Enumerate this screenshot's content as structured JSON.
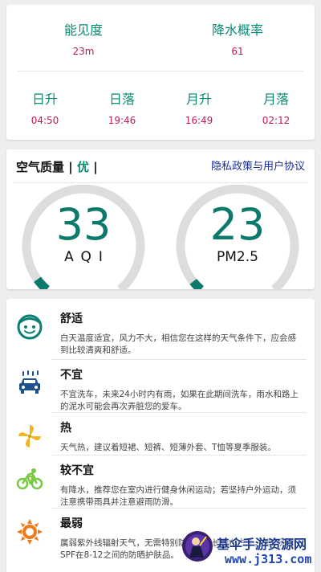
{
  "astro": {
    "visibility": {
      "label": "能见度",
      "value": "23m"
    },
    "precip_chance": {
      "label": "降水概率",
      "value": "61"
    },
    "sunrise": {
      "label": "日升",
      "value": "04:50"
    },
    "sunset": {
      "label": "日落",
      "value": "19:46"
    },
    "moonrise": {
      "label": "月升",
      "value": "16:49"
    },
    "moonset": {
      "label": "月落",
      "value": "02:12"
    }
  },
  "air": {
    "title_prefix": "空气质量 |",
    "quality": "优",
    "title_suffix": "|",
    "privacy_link": "隐私政策与用户协议",
    "aqi": {
      "value": "33",
      "label": "AQI",
      "fill_fraction": 0.05
    },
    "pm25": {
      "value": "23",
      "label": "PM2.5",
      "fill_fraction": 0.04
    },
    "accent_color": "#0b7a6a",
    "track_color": "#dddddd"
  },
  "life": {
    "items": [
      {
        "icon": "smiley-face-icon",
        "title": "舒适",
        "desc": "白天温度适宜，风力不大，相信您在这样的天气条件下，应会感到比较清爽和舒适。"
      },
      {
        "icon": "car-wash-icon",
        "title": "不宜",
        "desc": "不宜洗车，未来24小时内有雨，如果在此期间洗车，雨水和路上的泥水可能会再次弄脏您的爱车。"
      },
      {
        "icon": "pinwheel-icon",
        "title": "热",
        "desc": "天气热，建议着短裙、短裤、短薄外套、T恤等夏季服装。"
      },
      {
        "icon": "cyclist-icon",
        "title": "较不宜",
        "desc": "有降水，推荐您在室内进行健身休闲运动；若坚持户外运动，须注意携带雨具并注意避雨防滑。"
      },
      {
        "icon": "sun-icon",
        "title": "最弱",
        "desc": "属弱紫外线辐射天气，无需特别防护。若长期在户外，建议涂擦SPF在8-12之间的防晒护肤品。"
      }
    ]
  },
  "watermark": {
    "title": "基伞手游资源网",
    "url": "www.j313.com"
  }
}
